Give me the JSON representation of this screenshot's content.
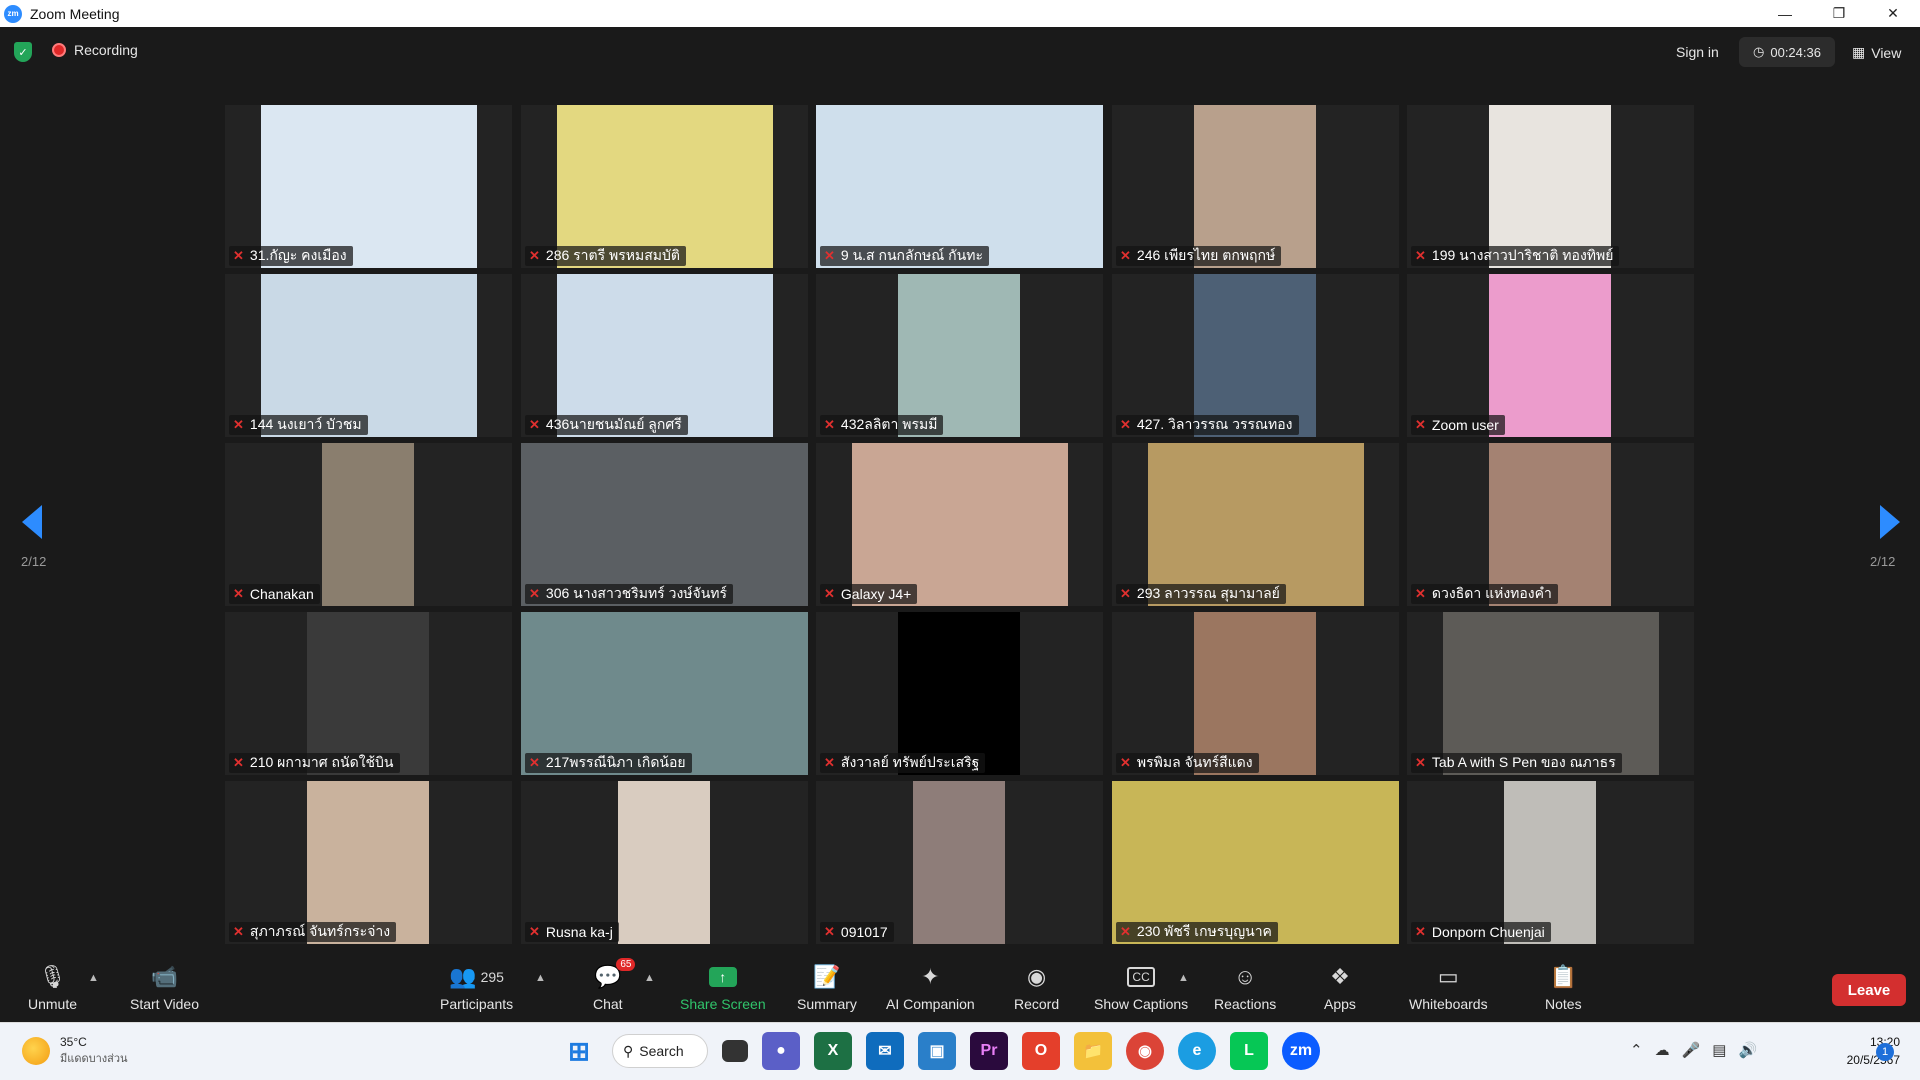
{
  "window": {
    "title": "Zoom Meeting",
    "app_icon": "zm"
  },
  "topbar": {
    "recording_label": "Recording",
    "signin_label": "Sign in",
    "timer": "00:24:36",
    "view_label": "View"
  },
  "pagination": {
    "left": "2/12",
    "right": "2/12"
  },
  "participants": [
    {
      "name": "31.กัญะ คงเมือง",
      "bg": "#dbe7f2",
      "vw": 216,
      "vx": 36
    },
    {
      "name": "286 ราตรี พรหมสมบัติ",
      "bg": "#e3d880",
      "vw": 216,
      "vx": 36
    },
    {
      "name": "9 น.ส กนกลักษณ์ กันทะ",
      "bg": "#cfdfec",
      "vw": 287,
      "vx": 0
    },
    {
      "name": "246 เพียรไทย ตกพฤกษ์",
      "bg": "#b8a08c",
      "vw": 122,
      "vx": 82
    },
    {
      "name": "199 นางสาวปาริชาติ ทองทิพย์",
      "bg": "#e8e4df",
      "vw": 122,
      "vx": 82
    },
    {
      "name": "144 นงเยาว์ บัวชม",
      "bg": "#c9d9e6",
      "vw": 216,
      "vx": 36
    },
    {
      "name": "436นายชนมัณย์ ลูกศรี",
      "bg": "#cddcea",
      "vw": 216,
      "vx": 36
    },
    {
      "name": "432ลลิตา พรมมี",
      "bg": "#9fb8b4",
      "vw": 122,
      "vx": 82
    },
    {
      "name": "427. วิลาวรรณ วรรณทอง",
      "bg": "#4d6075",
      "vw": 122,
      "vx": 82
    },
    {
      "name": "Zoom user",
      "bg": "#ec9ccc",
      "vw": 122,
      "vx": 82
    },
    {
      "name": "Chanakan",
      "bg": "#8a7e6e",
      "vw": 92,
      "vx": 97
    },
    {
      "name": "306 นางสาวชริมทร์ วงษ์จันทร์",
      "bg": "#5b5f63",
      "vw": 287,
      "vx": 0
    },
    {
      "name": "Galaxy J4+",
      "bg": "#c9a694",
      "vw": 216,
      "vx": 36
    },
    {
      "name": "293 ลาวรรณ สุมามาลย์",
      "bg": "#b79a62",
      "vw": 216,
      "vx": 36
    },
    {
      "name": "ดวงธิดา แห่งทองคำ",
      "bg": "#a48272",
      "vw": 122,
      "vx": 82
    },
    {
      "name": "210 ผกามาศ ถนัดใช้บิน",
      "bg": "#3a3a3a",
      "vw": 122,
      "vx": 82
    },
    {
      "name": "217พรรณีนิภา เกิดน้อย",
      "bg": "#6f8a8c",
      "vw": 287,
      "vx": 0
    },
    {
      "name": "สังวาลย์ ทรัพย์ประเสริฐ",
      "bg": "#000000",
      "vw": 122,
      "vx": 82
    },
    {
      "name": "พรพิมล จันทร์สีแดง",
      "bg": "#9b7660",
      "vw": 122,
      "vx": 82
    },
    {
      "name": "Tab A with S Pen ของ ณภาธร",
      "bg": "#5d5b57",
      "vw": 216,
      "vx": 36
    },
    {
      "name": "สุภาภรณ์ จันทร์กระจ่าง",
      "bg": "#c9b29d",
      "vw": 122,
      "vx": 82
    },
    {
      "name": "Rusna ka-j",
      "bg": "#d9ccc0",
      "vw": 92,
      "vx": 97
    },
    {
      "name": "091017",
      "bg": "#8e7d79",
      "vw": 92,
      "vx": 97
    },
    {
      "name": "230 พัชรี เกษรบุญนาค",
      "bg": "#c8b657",
      "vw": 287,
      "vx": 0
    },
    {
      "name": "Donporn Chuenjai",
      "bg": "#bfbdb8",
      "vw": 92,
      "vx": 97
    }
  ],
  "toolbar": {
    "unmute": "Unmute",
    "start_video": "Start Video",
    "participants_count": "295",
    "participants": "Participants",
    "chat_badge": "65",
    "chat": "Chat",
    "share_screen": "Share Screen",
    "summary": "Summary",
    "ai_companion": "AI Companion",
    "record": "Record",
    "show_captions": "Show Captions",
    "reactions": "Reactions",
    "apps": "Apps",
    "whiteboards": "Whiteboards",
    "notes": "Notes",
    "leave": "Leave"
  },
  "taskbar": {
    "temperature": "35°C",
    "weather_text": "มีแดดบางส่วน",
    "search_label": "Search",
    "time": "13:20",
    "date": "20/5/2567",
    "notifications": "1"
  }
}
